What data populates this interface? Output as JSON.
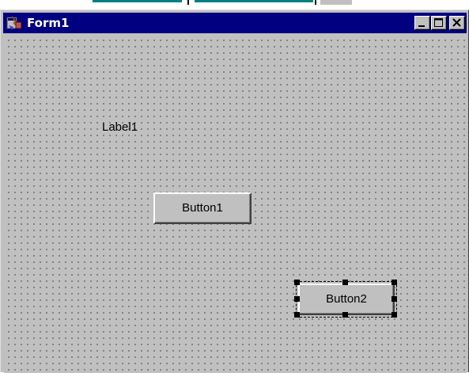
{
  "window": {
    "title": "Form1",
    "title_bar_color": "#000080",
    "client_bg_color": "#c0c0c0",
    "app_icon": "delphi-form-icon",
    "controls_icons": [
      "minimize-icon",
      "maximize-icon",
      "close-icon"
    ]
  },
  "form": {
    "label1": "Label1",
    "button1": "Button1",
    "button2": "Button2",
    "selected_control": "Button2"
  }
}
